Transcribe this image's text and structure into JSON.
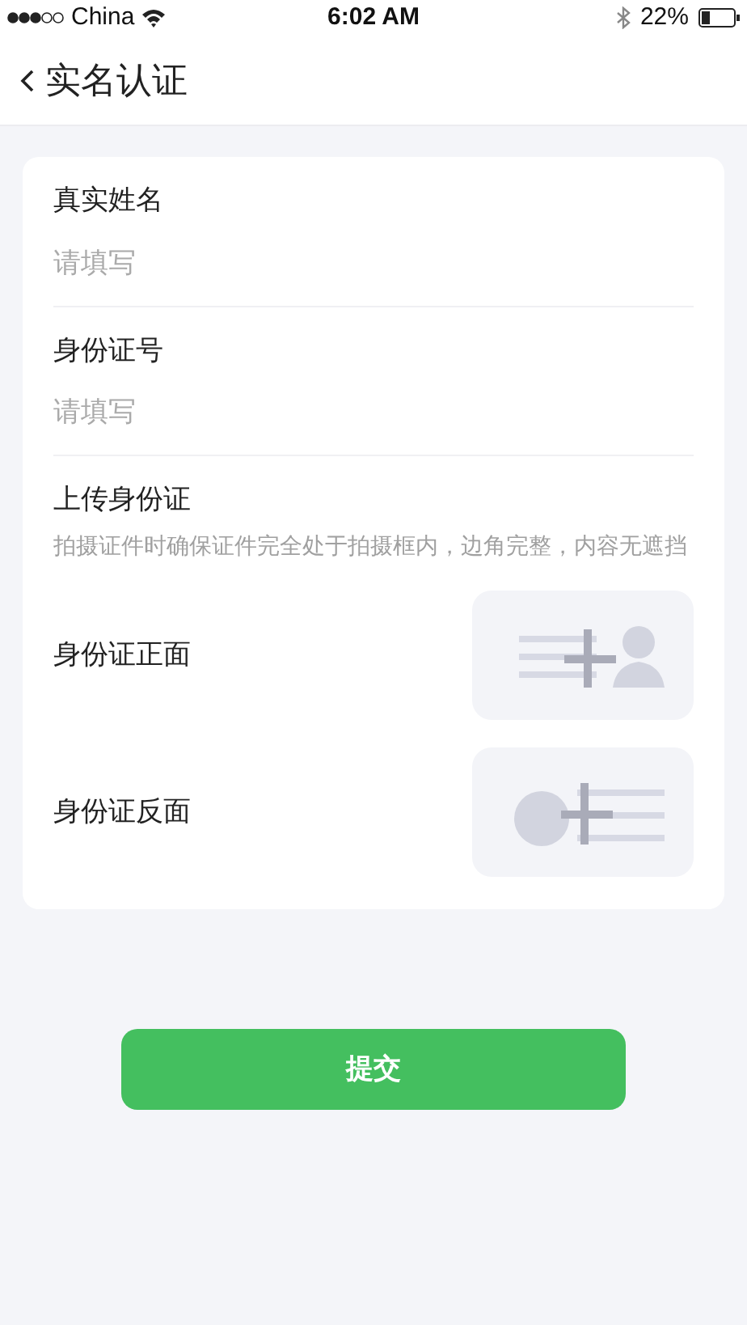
{
  "status_bar": {
    "carrier": "China",
    "time": "6:02 AM",
    "battery": "22%"
  },
  "nav": {
    "title": "实名认证"
  },
  "fields": [
    {
      "label": "真实姓名",
      "placeholder": "请填写"
    },
    {
      "label": "身份证号",
      "placeholder": "请填写"
    }
  ],
  "upload": {
    "title": "上传身份证",
    "hint": "拍摄证件时确保证件完全处于拍摄框内，边角完整，内容无遮挡",
    "items": [
      {
        "label": "身份证正面",
        "kind": "front"
      },
      {
        "label": "身份证反面",
        "kind": "back"
      }
    ]
  },
  "submit": "提交"
}
